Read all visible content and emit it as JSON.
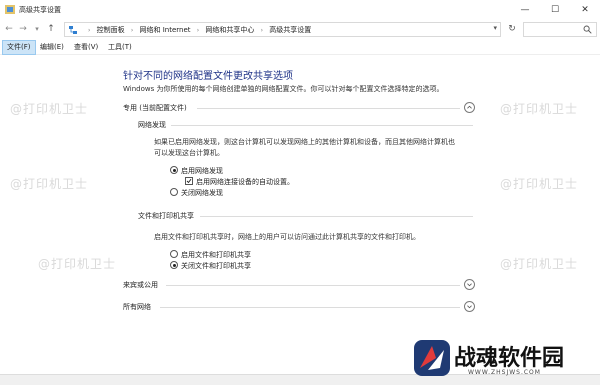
{
  "window": {
    "title": "高级共享设置",
    "controls": {
      "minimize": "—",
      "maximize": "☐",
      "close": "✕"
    }
  },
  "address": {
    "breadcrumbs": [
      "控制面板",
      "网络和 Internet",
      "网络和共享中心",
      "高级共享设置"
    ],
    "dropdown": "▾"
  },
  "nav": {
    "back": "←",
    "forward": "→",
    "recent": "▾",
    "up": "↑",
    "refresh": "↻"
  },
  "menu": [
    "文件(F)",
    "编辑(E)",
    "查看(V)",
    "工具(T)"
  ],
  "main": {
    "title": "针对不同的网络配置文件更改共享选项",
    "description": "Windows 为你所使用的每个网络创建单独的网络配置文件。你可以针对每个配置文件选择特定的选项。",
    "private": {
      "header": "专用 (当前配置文件)",
      "network_discovery": {
        "title": "网络发现",
        "desc_line1": "如果已启用网络发现，则这台计算机可以发现网络上的其他计算机和设备，而且其他网络计算机也",
        "desc_line2": "可以发现这台计算机。",
        "on": "启用网络发现",
        "auto": "启用网络连接设备的自动设置。",
        "off": "关闭网络发现",
        "state": {
          "on": true,
          "auto": true,
          "off": false
        }
      },
      "file_printer": {
        "title": "文件和打印机共享",
        "desc": "启用文件和打印机共享时，网络上的用户可以访问通过此计算机共享的文件和打印机。",
        "on": "启用文件和打印机共享",
        "off": "关闭文件和打印机共享",
        "state": {
          "on": false,
          "off": true
        }
      }
    },
    "guest": {
      "header": "来宾或公用"
    },
    "all": {
      "header": "所有网络"
    }
  },
  "watermark": "@打印机卫士",
  "logo": {
    "text": "战魂软件园",
    "url": "WWW.ZHSJWS.COM"
  }
}
